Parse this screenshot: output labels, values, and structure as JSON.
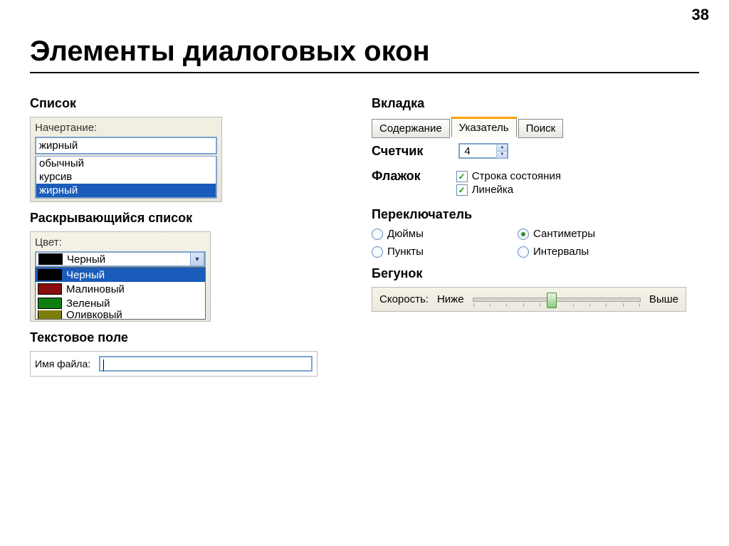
{
  "page_number": "38",
  "title": "Элементы диалоговых окон",
  "list": {
    "section_label": "Список",
    "caption": "Начертание:",
    "input_value": "жирный",
    "items": [
      "обычный",
      "курсив",
      "жирный"
    ],
    "selected_index": 2
  },
  "dropdown": {
    "section_label": "Раскрывающийся список",
    "caption": "Цвет:",
    "current_name": "Черный",
    "items": [
      {
        "name": "Черный",
        "color": "#000000"
      },
      {
        "name": "Малиновый",
        "color": "#8b0d0d"
      },
      {
        "name": "Зеленый",
        "color": "#0f7d0f"
      },
      {
        "name": "Оливковый",
        "color": "#7d7d0f"
      }
    ],
    "open_selected_index": 0
  },
  "textfield": {
    "section_label": "Текстовое поле",
    "label": "Имя файла:",
    "value": ""
  },
  "tabs": {
    "section_label": "Вкладка",
    "items": [
      "Содержание",
      "Указатель",
      "Поиск"
    ],
    "active_index": 1
  },
  "spinner": {
    "section_label": "Счетчик",
    "value": "4"
  },
  "checkbox": {
    "section_label": "Флажок",
    "items": [
      {
        "label": "Строка состояния",
        "checked": true
      },
      {
        "label": "Линейка",
        "checked": true
      }
    ]
  },
  "radio": {
    "section_label": "Переключатель",
    "items": [
      {
        "label": "Дюймы",
        "checked": false
      },
      {
        "label": "Сантиметры",
        "checked": true
      },
      {
        "label": "Пункты",
        "checked": false
      },
      {
        "label": "Интервалы",
        "checked": false
      }
    ]
  },
  "slider": {
    "section_label": "Бегунок",
    "label": "Скорость:",
    "min_label": "Ниже",
    "max_label": "Выше",
    "position_percent": 44
  }
}
